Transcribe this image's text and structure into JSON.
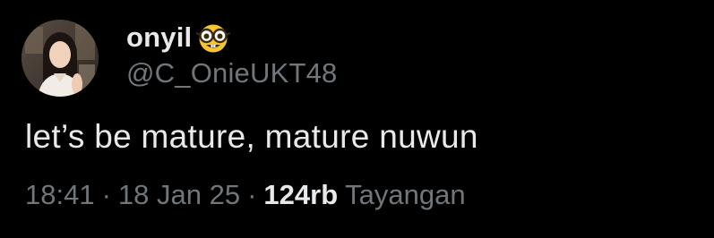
{
  "tweet": {
    "display_name": "onyil",
    "name_emoji": "nerd-face-emoji",
    "handle": "@C_OnieUKT48",
    "text": "let’s be mature, mature nuwun",
    "time": "18:41",
    "separator": "·",
    "date": "18 Jan 25",
    "views_count": "124rb",
    "views_label": "Tayangan"
  },
  "colors": {
    "background": "#000000",
    "primary_text": "#e7e9ea",
    "secondary_text": "#71767b",
    "emoji_yellow": "#f7c531"
  }
}
